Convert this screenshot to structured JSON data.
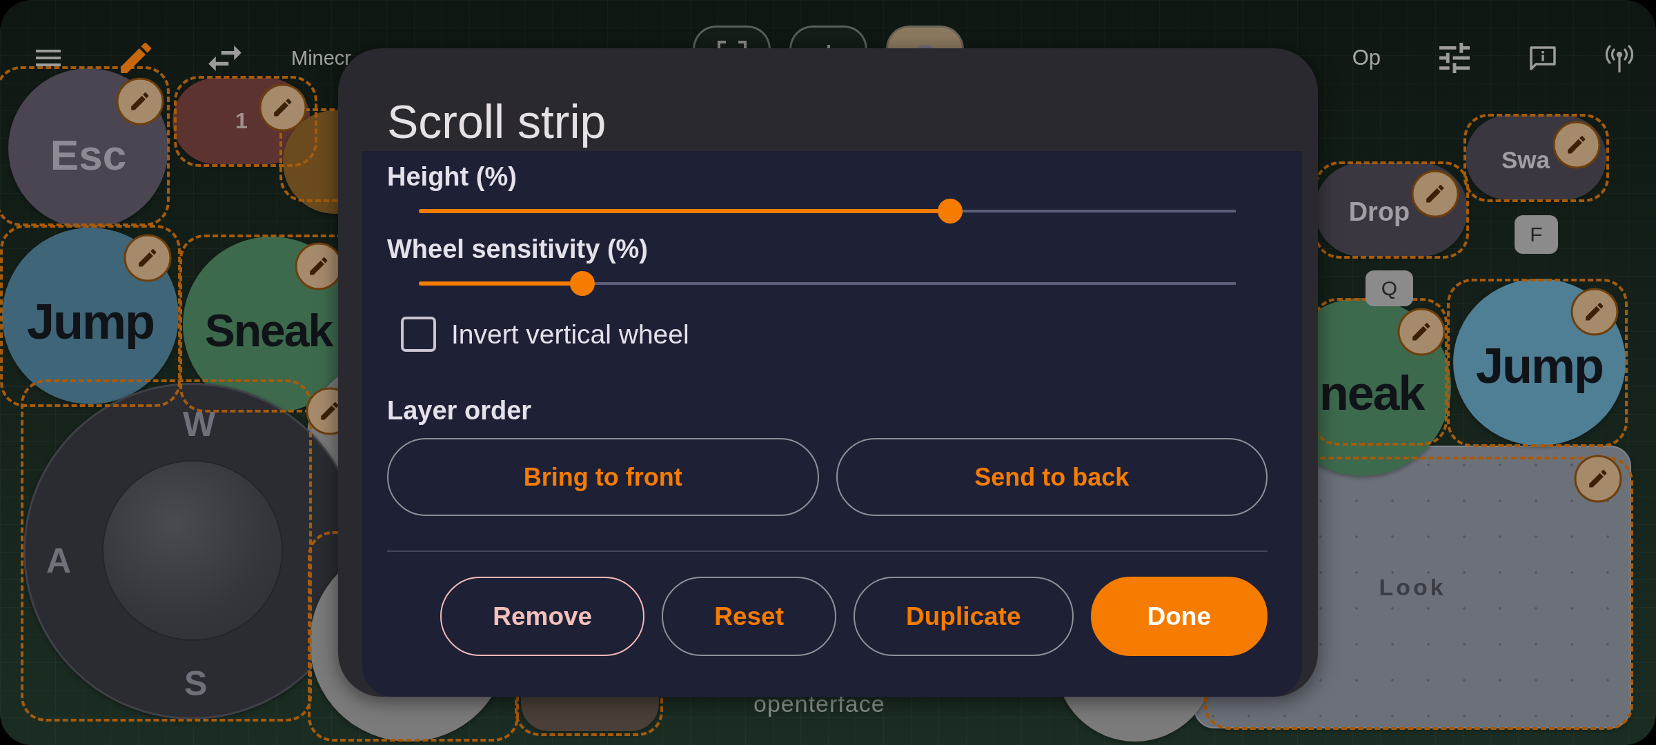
{
  "top_bar": {
    "title": "Minecr",
    "label": "Op",
    "toolbar_buttons": [
      {
        "selected": false
      },
      {
        "selected": false
      },
      {
        "selected": true
      }
    ]
  },
  "canvas": {
    "edit_mode": true,
    "controls": [
      {
        "kind": "round",
        "label": "Esc",
        "color": "#4a4551",
        "edit_badge": true
      },
      {
        "kind": "pill",
        "label": "1",
        "color": "#5c3331",
        "edit_badge": true
      },
      {
        "kind": "round",
        "color": "#6b4b1e"
      },
      {
        "kind": "round",
        "label": "Jump",
        "color": "#3f6578",
        "edit_badge": true
      },
      {
        "kind": "round",
        "label": "Sneak",
        "color": "#3d6a4d",
        "edit_badge": true
      },
      {
        "kind": "round",
        "color": "#7a7a7a",
        "edit_badge": true
      },
      {
        "kind": "joystick",
        "keys": {
          "up": "W",
          "left": "A",
          "down": "S"
        },
        "color": "#2b2c32"
      },
      {
        "kind": "round",
        "color": "#7b7b7b"
      },
      {
        "kind": "pill",
        "color": "#4a4039"
      },
      {
        "kind": "round",
        "color": "#7b7b7b"
      },
      {
        "kind": "pill",
        "label": "Drop",
        "color": "#3a3740",
        "edit_badge": true
      },
      {
        "kind": "pill",
        "label": "Swa",
        "color": "#3a3740",
        "edit_badge": true
      },
      {
        "kind": "key_tag",
        "label": "F"
      },
      {
        "kind": "key_tag",
        "label": "Q"
      },
      {
        "kind": "round",
        "label": "neak",
        "color": "#3d6a4d",
        "edit_badge": true
      },
      {
        "kind": "round",
        "label": "Jump",
        "color": "#4f7f95",
        "edit_badge": true
      },
      {
        "kind": "pad",
        "label": "Look",
        "color": "#6b7079",
        "edit_badge": true
      }
    ],
    "brand": "openterface"
  },
  "dialog": {
    "title": "Scroll strip",
    "settings": [
      {
        "kind": "slider",
        "label": "Height (%)",
        "level": 0.65
      },
      {
        "kind": "slider",
        "label": "Wheel sensitivity (%)",
        "level": 0.2
      },
      {
        "kind": "checkbox",
        "label": "Invert vertical wheel",
        "checked": false
      }
    ],
    "section": {
      "title": "Layer order",
      "buttons": [
        "Bring to front",
        "Send to back"
      ]
    },
    "actions": [
      {
        "kind": "danger",
        "label": "Remove"
      },
      {
        "kind": "outlined",
        "label": "Reset"
      },
      {
        "kind": "outlined",
        "label": "Duplicate"
      },
      {
        "kind": "filled",
        "label": "Done"
      }
    ]
  }
}
